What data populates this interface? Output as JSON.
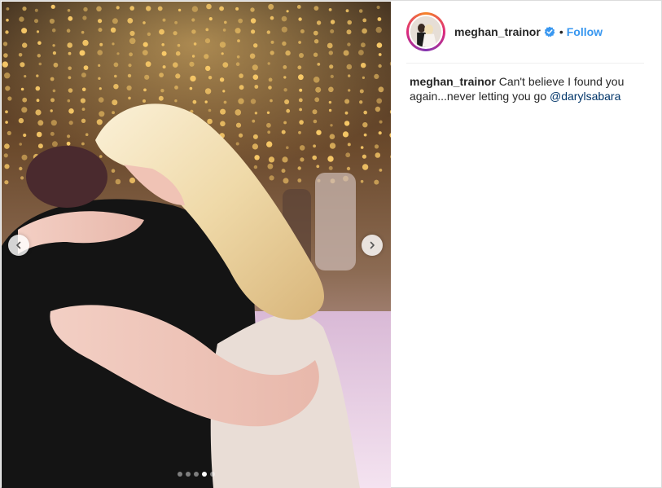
{
  "post": {
    "media": {
      "carousel": {
        "total": 5,
        "active_index": 3
      }
    },
    "header": {
      "username": "meghan_trainor",
      "verified": true,
      "separator": "•",
      "follow_label": "Follow"
    },
    "caption": {
      "username": "meghan_trainor",
      "text": "Can't believe I found you again...never letting you go",
      "mention": "@darylsabara"
    }
  },
  "colors": {
    "follow": "#3897f0",
    "verified": "#3897f0",
    "mention": "#003569",
    "text": "#262626"
  },
  "icons": {
    "prev": "chevron-left-icon",
    "next": "chevron-right-icon",
    "verified": "verified-badge-icon"
  }
}
